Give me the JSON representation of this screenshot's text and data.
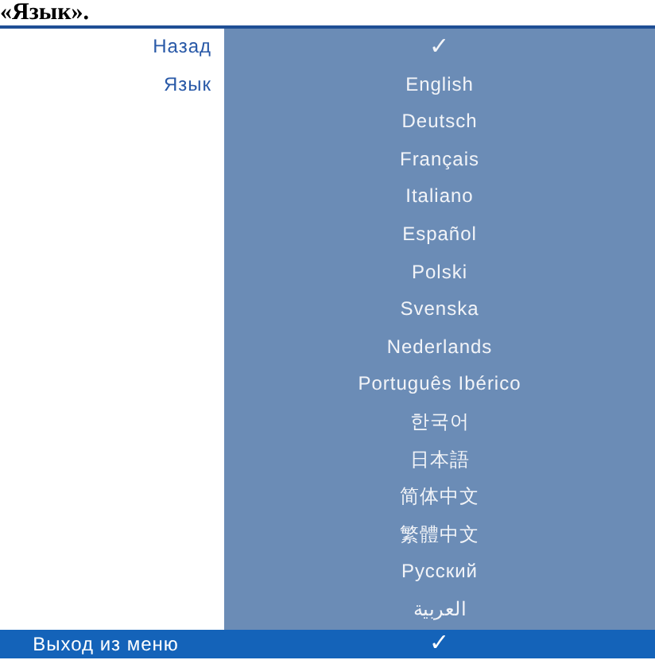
{
  "caption": "«Язык».",
  "rows": [
    {
      "label": "Назад",
      "value": "✓",
      "selected": false
    },
    {
      "label": "Язык",
      "value": "English",
      "selected": false
    },
    {
      "value": "Deutsch",
      "selected": false
    },
    {
      "value": "Français",
      "selected": false
    },
    {
      "value": "Italiano",
      "selected": false
    },
    {
      "value": "Español",
      "selected": false
    },
    {
      "value": "Polski",
      "selected": false
    },
    {
      "value": "Svenska",
      "selected": false
    },
    {
      "value": "Nederlands",
      "selected": false
    },
    {
      "value": "Português Ibérico",
      "selected": false
    },
    {
      "value": "한국어",
      "selected": false
    },
    {
      "value": "日本語",
      "selected": false
    },
    {
      "value": "简体中文",
      "selected": false
    },
    {
      "value": "繁體中文",
      "selected": false
    },
    {
      "value": "Русский",
      "selected": false
    },
    {
      "value": "العربية",
      "selected": false
    },
    {
      "label": "Выход из меню",
      "value": "✓",
      "selected": true
    }
  ]
}
